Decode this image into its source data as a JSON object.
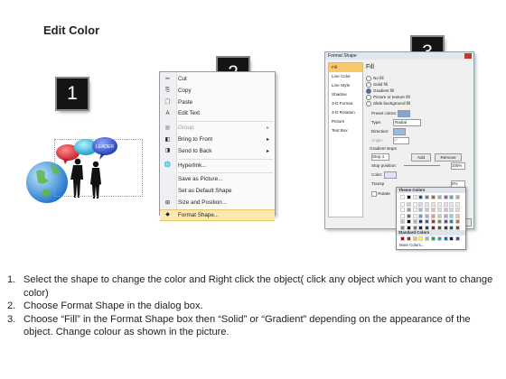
{
  "title": "Edit Color",
  "steps": [
    "1",
    "2",
    "3"
  ],
  "context_menu": {
    "items": [
      {
        "label": "Cut",
        "icon": "scissors-icon",
        "disabled": false,
        "submenu": false
      },
      {
        "label": "Copy",
        "icon": "copy-icon",
        "disabled": false,
        "submenu": false
      },
      {
        "label": "Paste",
        "icon": "paste-icon",
        "disabled": false,
        "submenu": false
      },
      {
        "label": "Edit Text",
        "icon": "edit-text-icon",
        "disabled": false,
        "submenu": false
      },
      {
        "label": "Group",
        "icon": "group-icon",
        "disabled": true,
        "submenu": true
      },
      {
        "label": "Bring to Front",
        "icon": "bring-front-icon",
        "disabled": false,
        "submenu": true
      },
      {
        "label": "Send to Back",
        "icon": "send-back-icon",
        "disabled": false,
        "submenu": true
      },
      {
        "label": "Hyperlink...",
        "icon": "hyperlink-icon",
        "disabled": false,
        "submenu": false
      },
      {
        "label": "Save as Picture...",
        "icon": "",
        "disabled": false,
        "submenu": false
      },
      {
        "label": "Set as Default Shape",
        "icon": "",
        "disabled": false,
        "submenu": false
      },
      {
        "label": "Size and Position...",
        "icon": "size-icon",
        "disabled": false,
        "submenu": false
      },
      {
        "label": "Format Shape...",
        "icon": "format-shape-icon",
        "disabled": false,
        "submenu": false,
        "highlighted": true
      }
    ]
  },
  "dialog": {
    "title": "Format Shape",
    "sidebar": [
      "Fill",
      "Line Color",
      "Line Style",
      "Shadow",
      "3-D Format",
      "3-D Rotation",
      "Picture",
      "Text Box"
    ],
    "heading": "Fill",
    "options": [
      "No fill",
      "Solid fill",
      "Gradient fill",
      "Picture or texture fill",
      "Slide background fill"
    ],
    "selected_option": "Gradient fill",
    "preset_label": "Preset colors:",
    "type_label": "Type:",
    "type_value": "Radial",
    "direction_label": "Direction:",
    "angle_label": "Angle:",
    "angle_value": "0°",
    "stops_label": "Gradient stops",
    "stop_value": "Stop 1",
    "add_label": "Add",
    "remove_label": "Remove",
    "stop_position_label": "Stop position:",
    "stop_position_value": "100%",
    "color_label": "Color:",
    "transparency_label": "Transp",
    "transparency_value": "0%",
    "rotate_label": "Rotate",
    "close_label": "Close"
  },
  "palette": {
    "theme_label": "Theme Colors",
    "standard_label": "Standard Colors",
    "more_label": "More Colors...",
    "theme_top": [
      "#ffffff",
      "#000000",
      "#eeece1",
      "#1f497d",
      "#4f81bd",
      "#c0504d",
      "#9bbb59",
      "#8064a2",
      "#4bacc6",
      "#f79646"
    ],
    "standard": [
      "#c00000",
      "#ff0000",
      "#ffc000",
      "#ffff00",
      "#92d050",
      "#00b050",
      "#00b0f0",
      "#0070c0",
      "#002060",
      "#7030a0"
    ]
  },
  "illustration": {
    "bubble_text": "LEADER",
    "colors": {
      "bubble_red": "#d8323c",
      "bubble_cyan": "#23b8d8",
      "bubble_blue": "#2a54c8",
      "globe": "#2f8fd6"
    }
  },
  "instructions": [
    {
      "num": "1.",
      "text": "Select the shape to change the color and Right click the object( click any object which you want to change color)"
    },
    {
      "num": "2.",
      "text": "Choose Format Shape in the dialog box."
    },
    {
      "num": "3.",
      "text": "Choose “Fill” in the Format Shape box then “Solid” or “Gradient” depending on the appearance of the object. Change colour as shown in the picture."
    }
  ]
}
